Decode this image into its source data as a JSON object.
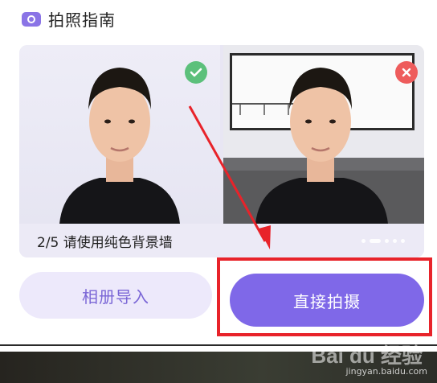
{
  "header": {
    "title": "拍照指南",
    "icon": "camera-icon"
  },
  "guide": {
    "caption": "2/5 请使用纯色背景墙",
    "good_badge_icon": "check-icon",
    "bad_badge_icon": "close-icon",
    "good_color": "#5cc07b",
    "bad_color": "#ee5c5c",
    "page_indicator": {
      "pages": 5,
      "current": 2
    }
  },
  "actions": {
    "import_label": "相册导入",
    "shoot_label": "直接拍摄"
  },
  "colors": {
    "accent": "#7f68e8",
    "annotation": "#e8232a"
  },
  "watermark": {
    "brand": "Bai du 经验",
    "url": "jingyan.baidu.com"
  }
}
